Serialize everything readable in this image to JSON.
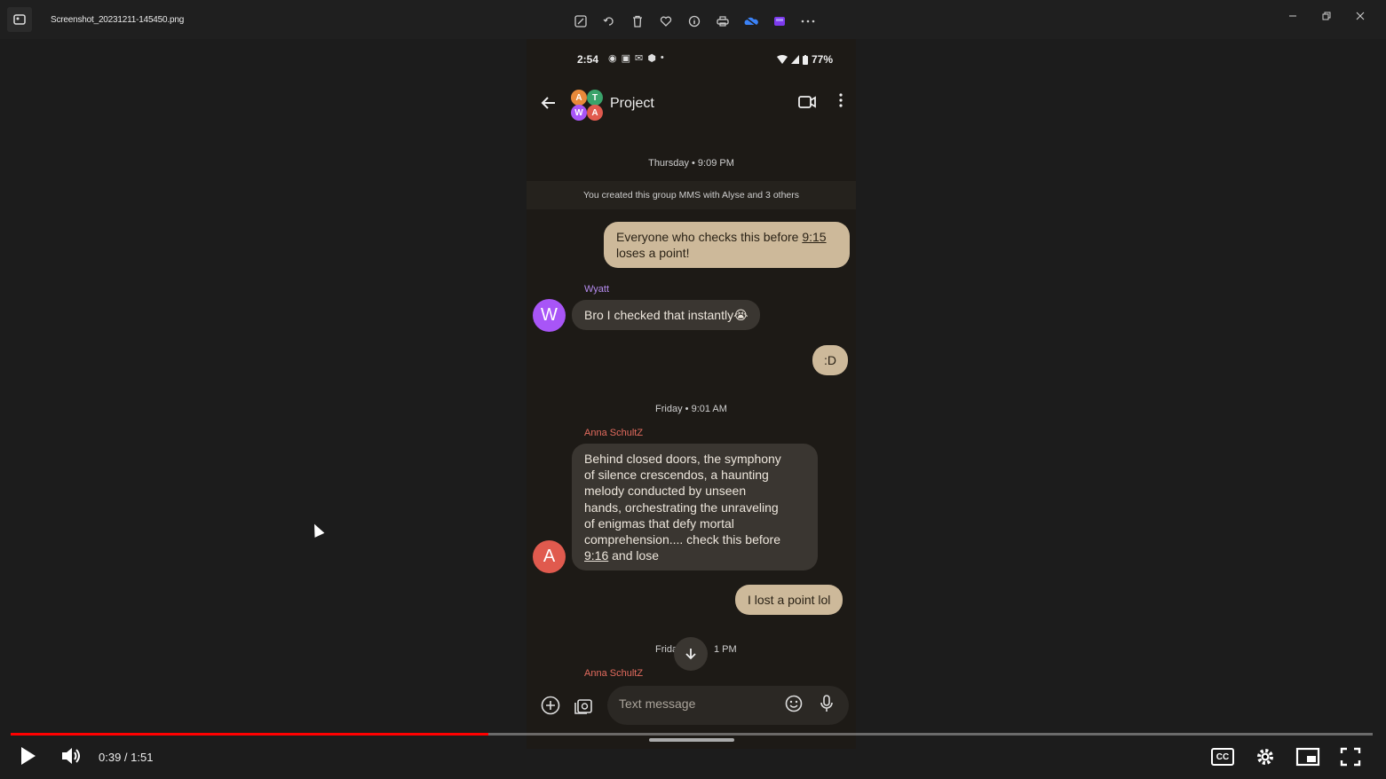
{
  "window": {
    "filename": "Screenshot_20231211-145450.png",
    "toolbar_icons": [
      "edit-icon",
      "rotate-icon",
      "delete-icon",
      "favorite-icon",
      "info-icon",
      "print-icon",
      "onedrive-icon",
      "clipchamp-icon",
      "more-icon"
    ],
    "controls": [
      "minimize-icon",
      "restore-icon",
      "close-icon"
    ]
  },
  "phone": {
    "status": {
      "time": "2:54",
      "battery": "77%"
    },
    "chat": {
      "title": "Project",
      "avatar_letters": [
        "A",
        "T",
        "W",
        "A"
      ]
    },
    "messages": {
      "ts1": "Thursday • 9:09 PM",
      "system": "You created this group MMS with Alyse and 3 others",
      "out1_a": "Everyone who checks this before ",
      "out1_link": "9:15",
      "out1_b": "loses a point!",
      "wyatt_name": "Wyatt",
      "wyatt_avatar": "W",
      "wyatt_msg": "Bro I checked that instantly😭",
      "out2": ":D",
      "ts2": "Friday • 9:01 AM",
      "anna_name": "Anna SchultZ",
      "anna_avatar": "A",
      "anna_msg_l1": "Behind closed doors, the symphony",
      "anna_msg_l2": "of silence crescendos, a haunting",
      "anna_msg_l3": "melody conducted by unseen",
      "anna_msg_l4": "hands, orchestrating the unraveling",
      "anna_msg_l5": "of enigmas that defy mortal",
      "anna_msg_l6": "comprehension.... check this before",
      "anna_msg_link": "9:16",
      "anna_msg_end": " and lose",
      "out3": "I lost a point lol",
      "ts3_left": "Frida",
      "ts3_right": "1 PM",
      "anna_name2": "Anna SchultZ"
    },
    "composer": {
      "placeholder": "Text message"
    }
  },
  "player": {
    "time_display": "0:39 / 1:51",
    "progress_fraction": 0.351,
    "cc_label": "CC"
  },
  "colors": {
    "progress": "#ff0000",
    "bubble_out": "#cdb99a",
    "bubble_in": "#3a3631",
    "wyatt": "#a855f7",
    "anna": "#e05a4e"
  }
}
